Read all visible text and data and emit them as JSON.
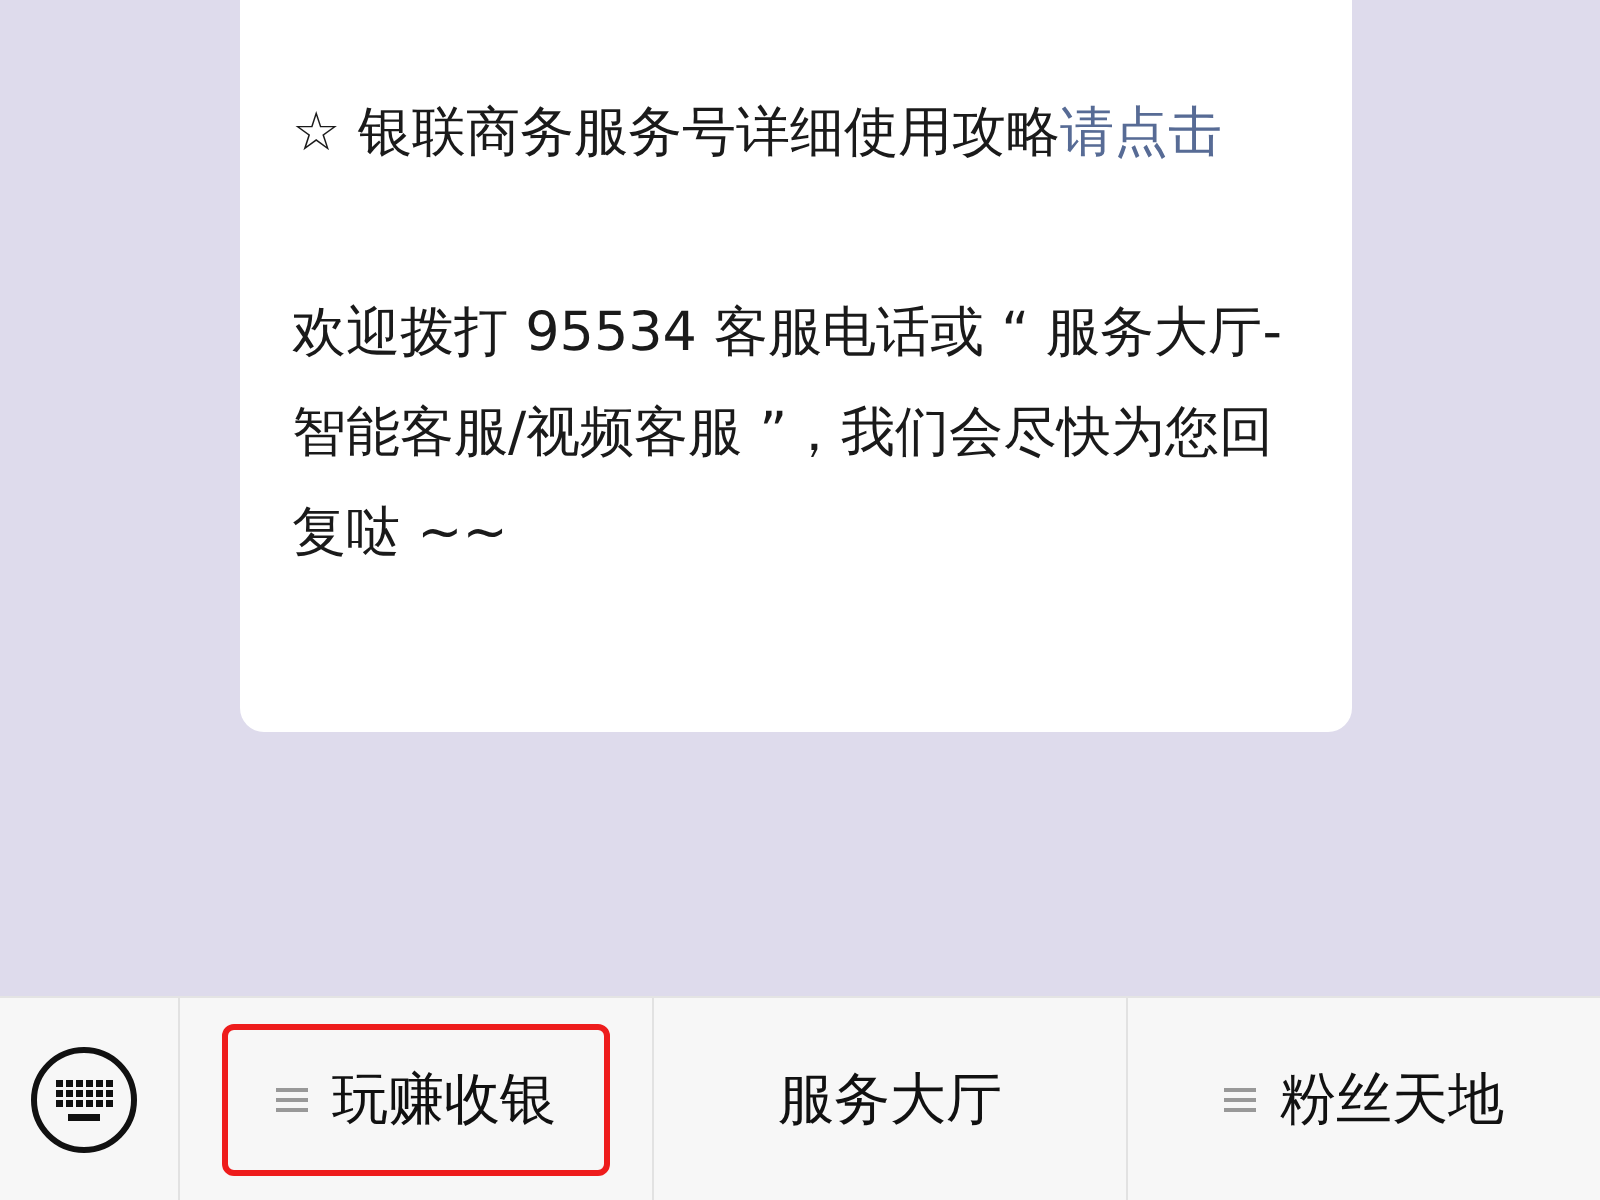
{
  "message": {
    "paragraphs": [
      {
        "text": "☆ 银联商务服务号详细使用攻略",
        "link": "请点击"
      },
      {
        "text": "欢迎拨打 95534 客服电话或 “ 服务大厅-智能客服/视频客服 ”，我们会尽快为您回复哒 ~~"
      }
    ]
  },
  "menu_bar": {
    "items": [
      {
        "label": "玩赚收银",
        "has_submenu": true,
        "highlighted": true
      },
      {
        "label": "服务大厅",
        "has_submenu": false,
        "highlighted": false
      },
      {
        "label": "粉丝天地",
        "has_submenu": true,
        "highlighted": false
      }
    ]
  }
}
